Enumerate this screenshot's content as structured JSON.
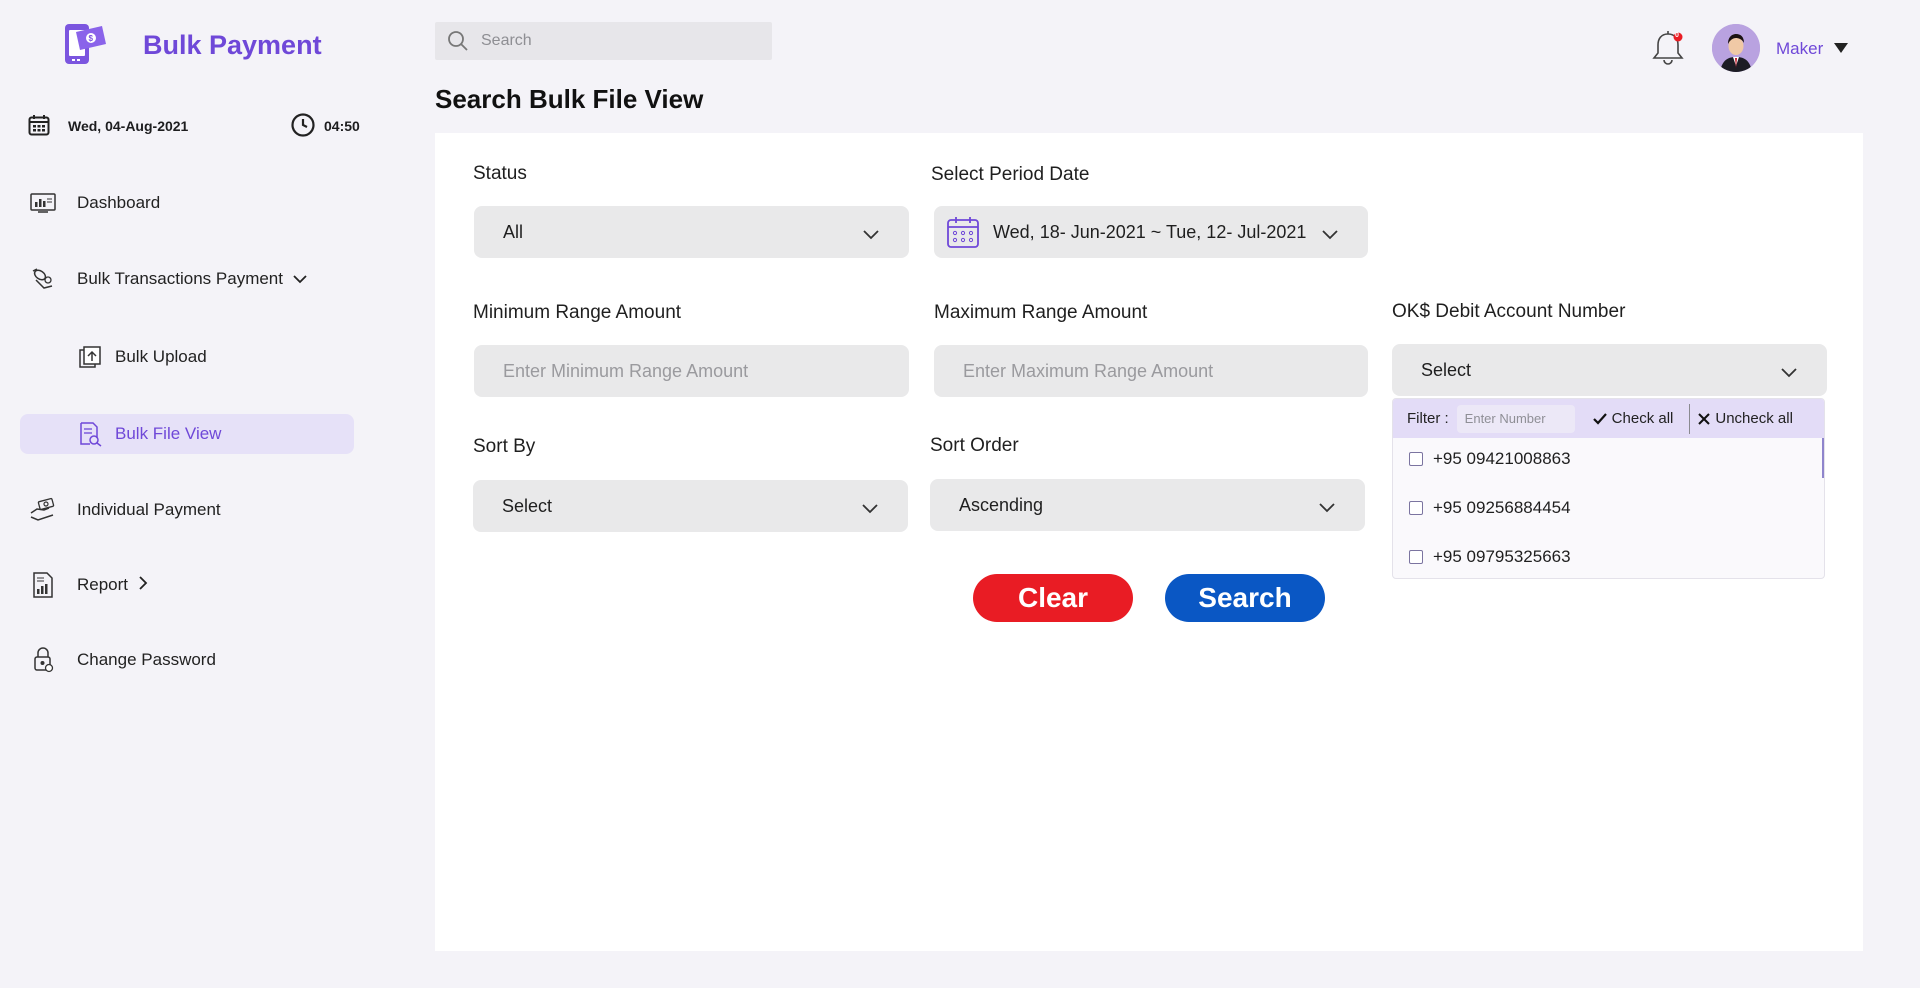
{
  "app": {
    "title": "Bulk Payment"
  },
  "sidebar": {
    "date": "Wed, 04-Aug-2021",
    "time": "04:50",
    "items": [
      {
        "label": "Dashboard"
      },
      {
        "label": "Bulk Transactions Payment"
      },
      {
        "label": "Bulk Upload"
      },
      {
        "label": "Bulk File View"
      },
      {
        "label": "Individual Payment"
      },
      {
        "label": "Report"
      },
      {
        "label": "Change Password"
      }
    ]
  },
  "header": {
    "search_placeholder": "Search",
    "notification_count": "0",
    "user_name": "Maker"
  },
  "page": {
    "title": "Search Bulk File View"
  },
  "form": {
    "status": {
      "label": "Status",
      "value": "All"
    },
    "period": {
      "label": "Select Period Date",
      "value": "Wed, 18- Jun-2021 ~ Tue, 12- Jul-2021"
    },
    "min_amount": {
      "label": "Minimum Range Amount",
      "placeholder": "Enter Minimum Range Amount"
    },
    "max_amount": {
      "label": "Maximum Range Amount",
      "placeholder": "Enter Maximum Range Amount"
    },
    "debit_account": {
      "label": "OK$ Debit Account Number",
      "value": "Select",
      "filter_label": "Filter :",
      "filter_placeholder": "Enter Number",
      "check_all": "Check all",
      "uncheck_all": "Uncheck all",
      "options": [
        "+95 09421008863",
        "+95 09256884454",
        "+95 09795325663"
      ]
    },
    "sort_by": {
      "label": "Sort By",
      "value": "Select"
    },
    "sort_order": {
      "label": "Sort Order",
      "value": "Ascending"
    },
    "clear_label": "Clear",
    "search_label": "Search"
  },
  "colors": {
    "accent": "#6f48d8",
    "clear": "#e91c24",
    "search": "#0a57c4",
    "active_bg": "#e6e1f8"
  }
}
